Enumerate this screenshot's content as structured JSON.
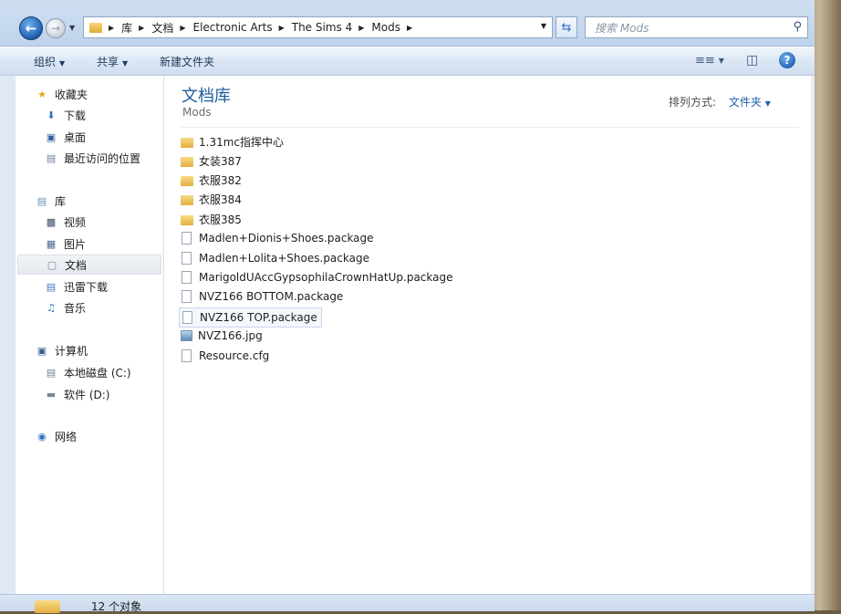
{
  "address": {
    "crumbs": [
      "库",
      "文档",
      "Electronic Arts",
      "The Sims 4",
      "Mods"
    ]
  },
  "search": {
    "placeholder": "搜索 Mods"
  },
  "toolbar": {
    "organize": "组织",
    "share": "共享",
    "new_folder": "新建文件夹"
  },
  "nav": {
    "favorites": "收藏夹",
    "downloads": "下载",
    "desktop": "桌面",
    "recent": "最近访问的位置",
    "libraries": "库",
    "videos": "视频",
    "pictures": "图片",
    "documents": "文档",
    "xunlei": "迅雷下载",
    "music": "音乐",
    "computer": "计算机",
    "disk_c": "本地磁盘 (C:)",
    "disk_d": "软件 (D:)",
    "network": "网络"
  },
  "content": {
    "title": "文档库",
    "subtitle": "Mods",
    "arrange_label": "排列方式:",
    "arrange_value": "文件夹"
  },
  "files": [
    {
      "name": "1.31mc指挥中心",
      "type": "folder"
    },
    {
      "name": "女装387",
      "type": "folder"
    },
    {
      "name": "衣服382",
      "type": "folder"
    },
    {
      "name": "衣服384",
      "type": "folder"
    },
    {
      "name": "衣服385",
      "type": "folder"
    },
    {
      "name": "Madlen+Dionis+Shoes.package",
      "type": "file"
    },
    {
      "name": "Madlen+Lolita+Shoes.package",
      "type": "file"
    },
    {
      "name": "MarigoldUAccGypsophilaCrownHatUp.package",
      "type": "file"
    },
    {
      "name": "NVZ166 BOTTOM.package",
      "type": "file"
    },
    {
      "name": "NVZ166 TOP.package",
      "type": "file",
      "selected": true
    },
    {
      "name": "NVZ166.jpg",
      "type": "image"
    },
    {
      "name": "Resource.cfg",
      "type": "file"
    }
  ],
  "status": {
    "count": "12 个对象"
  }
}
